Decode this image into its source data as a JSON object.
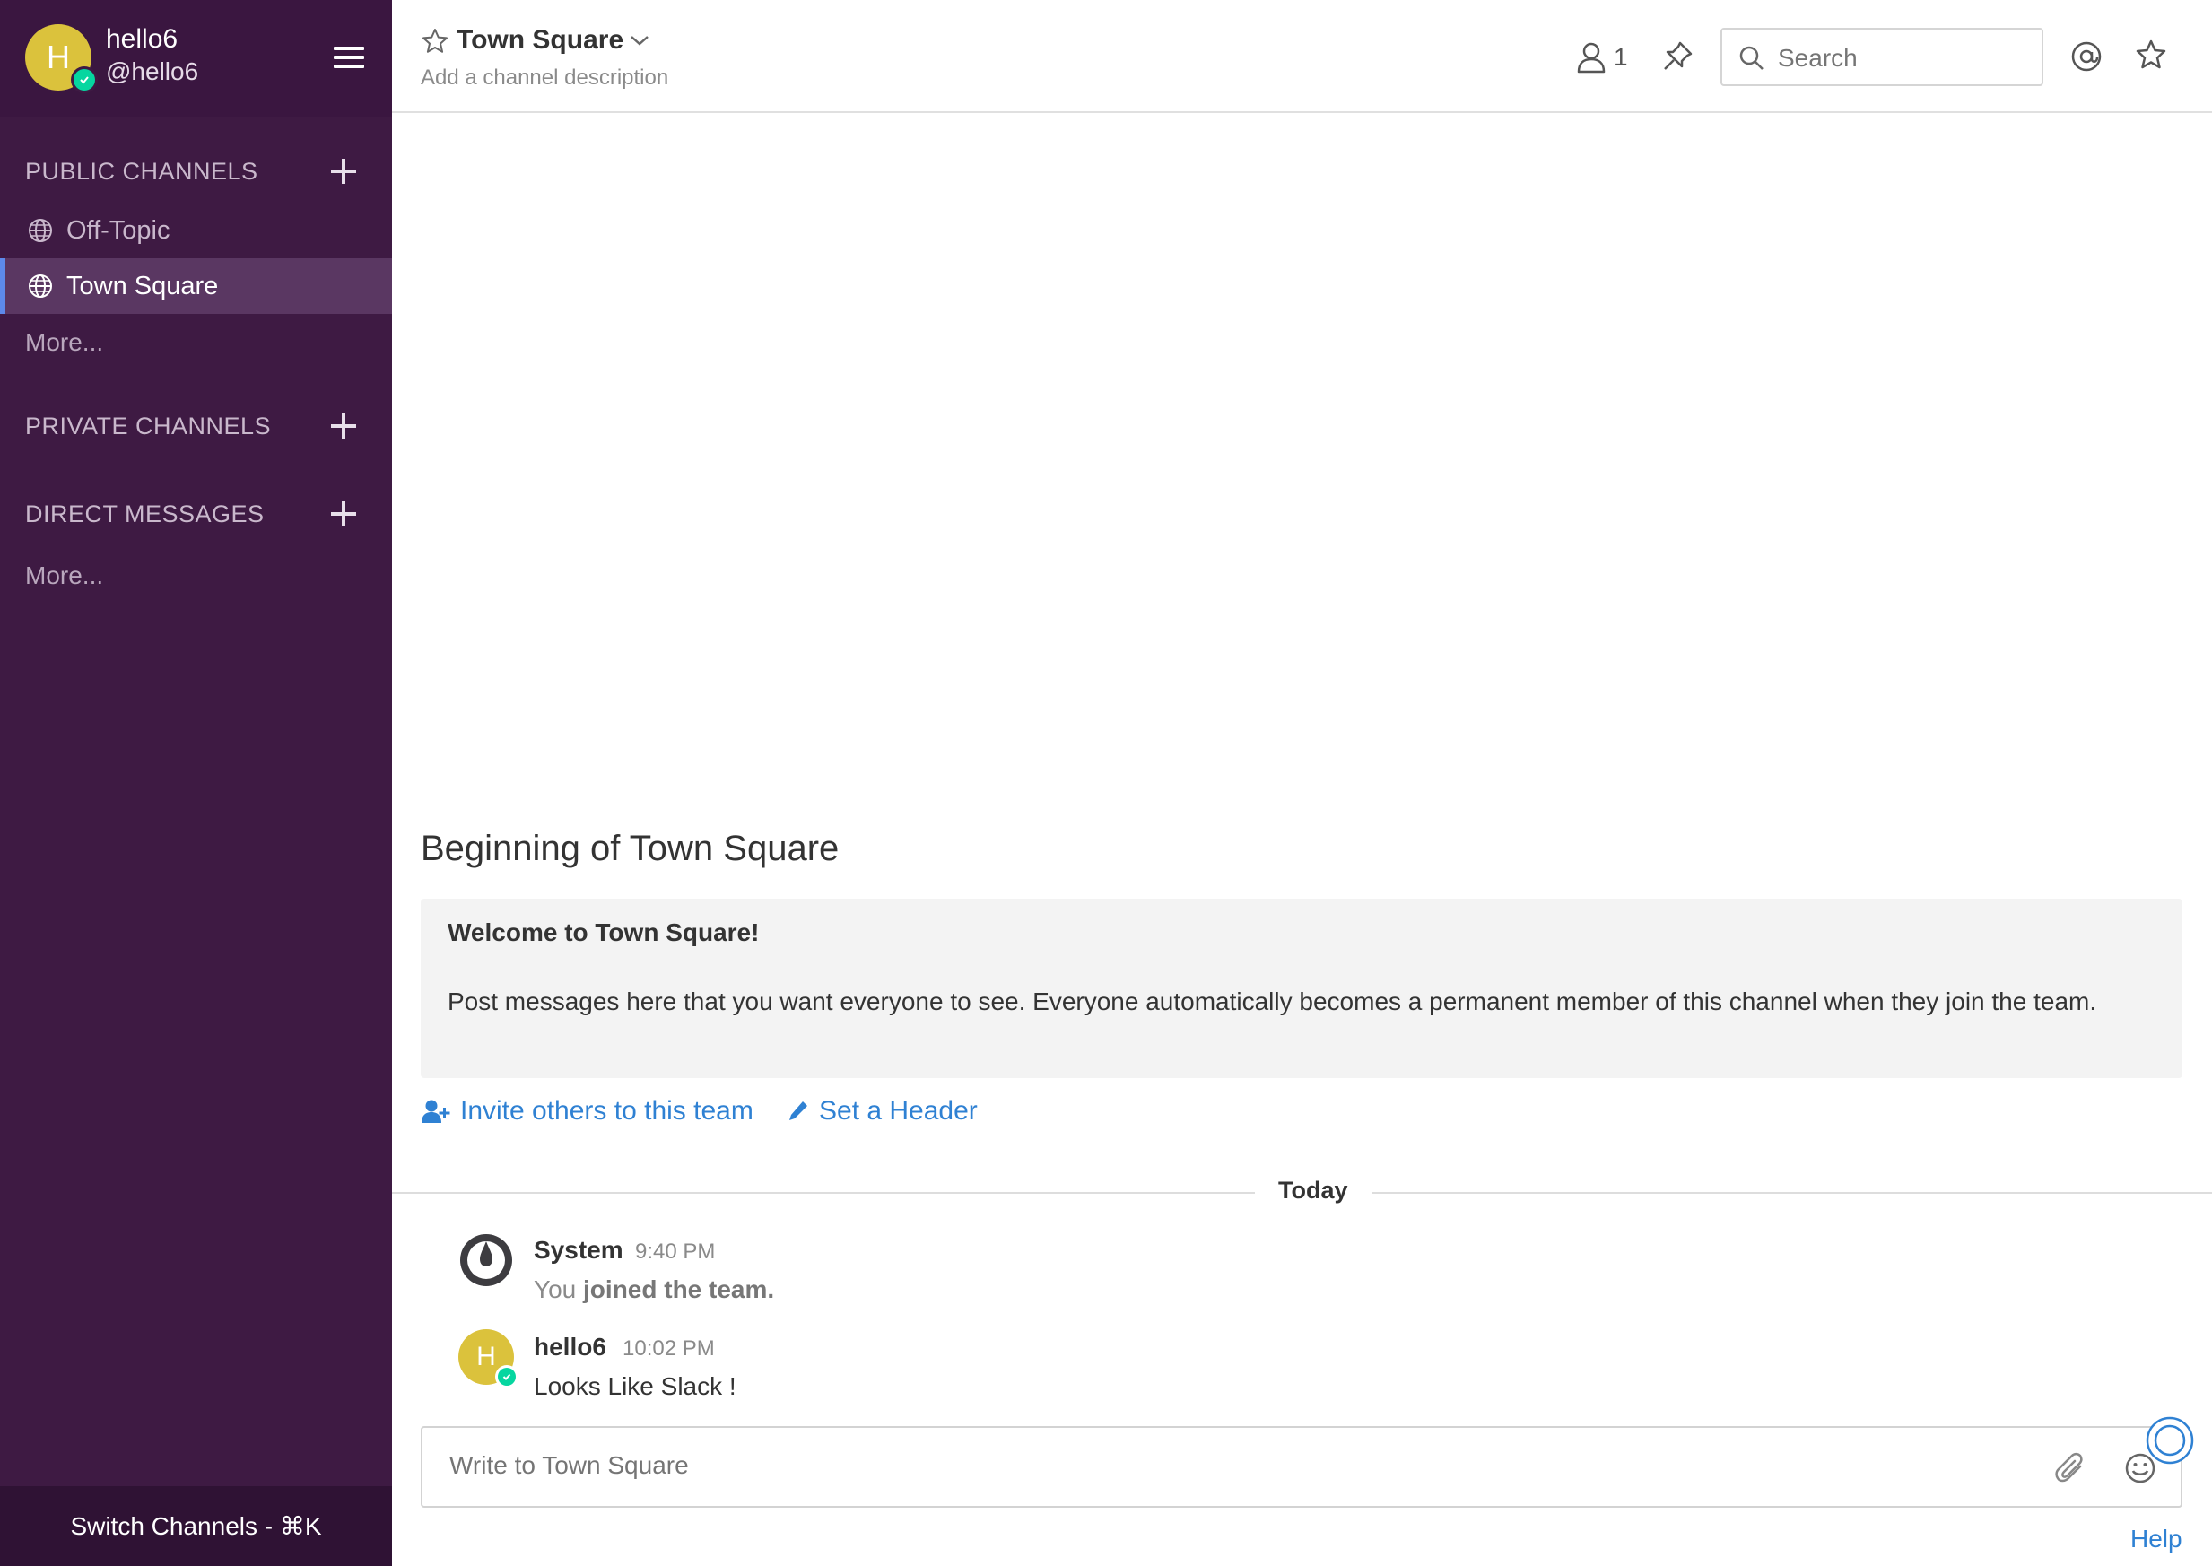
{
  "user": {
    "avatar_initial": "H",
    "username": "hello6",
    "handle": "@hello6"
  },
  "sidebar": {
    "sections": {
      "public": "PUBLIC CHANNELS",
      "private": "PRIVATE CHANNELS",
      "direct": "DIRECT MESSAGES"
    },
    "public_channels": [
      {
        "label": "Off-Topic",
        "active": false
      },
      {
        "label": "Town Square",
        "active": true
      }
    ],
    "more_public": "More...",
    "more_direct": "More...",
    "switch_channels": "Switch Channels - ⌘K"
  },
  "header": {
    "channel_name": "Town Square",
    "channel_description": "Add a channel description",
    "member_count": "1",
    "search_placeholder": "Search"
  },
  "intro": {
    "title": "Beginning of Town Square",
    "heading": "Welcome to Town Square!",
    "body": "Post messages here that you want everyone to see. Everyone automatically becomes a permanent member of this channel when they join the team.",
    "invite_link": "Invite others to this team",
    "header_link": "Set a Header"
  },
  "date_separator": "Today",
  "posts": [
    {
      "author": "System",
      "time": "9:40 PM",
      "message_prefix": "You",
      "message_bold": "joined the team."
    },
    {
      "author": "hello6",
      "avatar_initial": "H",
      "time": "10:02 PM",
      "message": "Looks Like Slack !"
    }
  ],
  "composer": {
    "placeholder": "Write to Town Square"
  },
  "help_link": "Help",
  "colors": {
    "sidebar_bg": "#3e1a43",
    "accent": "#2f81d3",
    "avatar": "#dbc23c",
    "online": "#06d6a0"
  }
}
